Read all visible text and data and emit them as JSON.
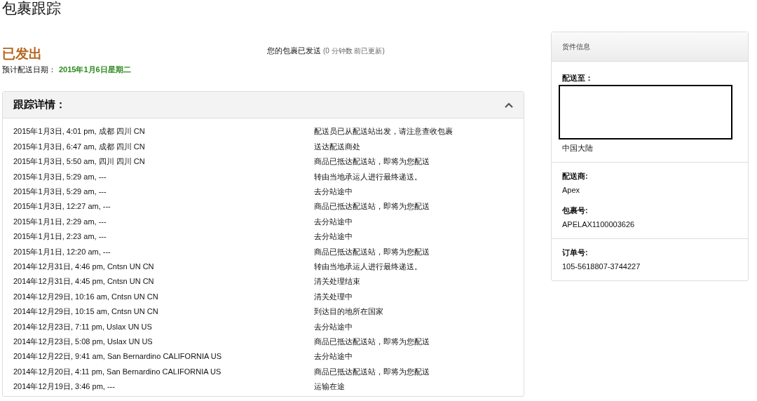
{
  "page_title": "包裹跟踪",
  "status": {
    "label": "已发出",
    "message": "您的包裹已发送",
    "updated": "(0 分钟数 前已更新)",
    "eta_label": "预计配送日期：",
    "eta_value": "2015年1月6日星期二"
  },
  "tracking": {
    "title": "跟踪详情：",
    "expanded": true,
    "rows": [
      {
        "time": "2015年1月3日, 4:01 pm, 成都 四川 CN",
        "event": "配送员已从配送站出发，请注意查收包裹"
      },
      {
        "time": "2015年1月3日, 6:47 am, 成都 四川 CN",
        "event": "送达配送商处"
      },
      {
        "time": "2015年1月3日, 5:50 am, 四川 四川 CN",
        "event": "商品已抵达配送站，即将为您配送"
      },
      {
        "time": "2015年1月3日, 5:29 am, ---",
        "event": "转由当地承运人进行最终递送。"
      },
      {
        "time": "2015年1月3日, 5:29 am, ---",
        "event": "去分站途中"
      },
      {
        "time": "2015年1月3日, 12:27 am, ---",
        "event": "商品已抵达配送站，即将为您配送"
      },
      {
        "time": "2015年1月1日, 2:29 am, ---",
        "event": "去分站途中"
      },
      {
        "time": "2015年1月1日, 2:23 am, ---",
        "event": "去分站途中"
      },
      {
        "time": "2015年1月1日, 12:20 am, ---",
        "event": "商品已抵达配送站，即将为您配送"
      },
      {
        "time": "2014年12月31日, 4:46 pm, Cntsn UN CN",
        "event": "转由当地承运人进行最终递送。"
      },
      {
        "time": "2014年12月31日, 4:45 pm, Cntsn UN CN",
        "event": "清关处理结束"
      },
      {
        "time": "2014年12月29日, 10:16 am, Cntsn UN CN",
        "event": "清关处理中"
      },
      {
        "time": "2014年12月29日, 10:15 am, Cntsn UN CN",
        "event": "到达目的地所在国家"
      },
      {
        "time": "2014年12月23日, 7:11 pm, Uslax UN US",
        "event": "去分站途中"
      },
      {
        "time": "2014年12月23日, 5:08 pm, Uslax UN US",
        "event": "商品已抵达配送站，即将为您配送"
      },
      {
        "time": "2014年12月22日, 9:41 am, San Bernardino CALIFORNIA US",
        "event": "去分站途中"
      },
      {
        "time": "2014年12月20日, 4:11 pm, San Bernardino CALIFORNIA US",
        "event": "商品已抵达配送站，即将为您配送"
      },
      {
        "time": "2014年12月19日, 3:46 pm, ---",
        "event": "运输在途"
      }
    ]
  },
  "shipment_info": {
    "title": "货件信息",
    "sections": [
      {
        "fields": [
          {
            "label": "配送至：",
            "value": "中国大陆",
            "redacted": true
          }
        ]
      },
      {
        "fields": [
          {
            "label": "配送商:",
            "value": "Apex",
            "redacted": false
          },
          {
            "label": "包裹号:",
            "value": "APELAX1100003626",
            "redacted": false
          }
        ]
      },
      {
        "fields": [
          {
            "label": "订单号:",
            "value": "105-5618807-3744227",
            "redacted": false
          }
        ]
      }
    ]
  }
}
